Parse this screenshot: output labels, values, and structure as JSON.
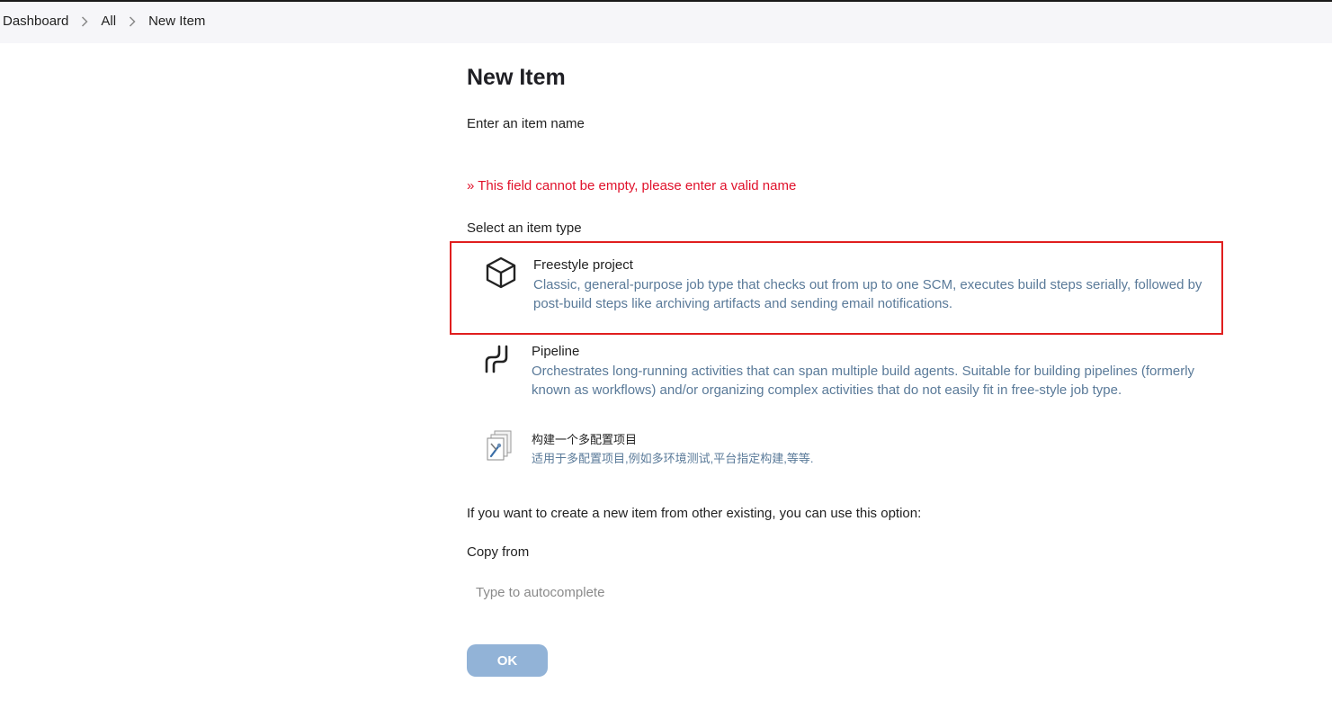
{
  "breadcrumb": [
    "Dashboard",
    "All",
    "New Item"
  ],
  "page_title": "New Item",
  "item_name_label": "Enter an item name",
  "item_name_error": "» This field cannot be empty, please enter a valid name",
  "item_type_label": "Select an item type",
  "item_types": [
    {
      "name": "Freestyle project",
      "description": "Classic, general-purpose job type that checks out from up to one SCM, executes build steps serially, followed by post-build steps like archiving artifacts and sending email notifications.",
      "icon": "cube-icon",
      "selected": true
    },
    {
      "name": "Pipeline",
      "description": "Orchestrates long-running activities that can span multiple build agents. Suitable for building pipelines (formerly known as workflows) and/or organizing complex activities that do not easily fit in free-style job type.",
      "icon": "pipeline-icon",
      "selected": false
    },
    {
      "name": "构建一个多配置项目",
      "description": "适用于多配置项目,例如多环境测试,平台指定构建,等等.",
      "icon": "multi-config-icon",
      "selected": false
    }
  ],
  "copy_hint": "If you want to create a new item from other existing, you can use this option:",
  "copy_from_label": "Copy from",
  "copy_from_placeholder": "Type to autocomplete",
  "ok_label": "OK",
  "colors": {
    "error": "#e0112b",
    "description": "#5a7a99",
    "selection_border": "#e01e1e",
    "ok_button": "#92b3d7"
  }
}
